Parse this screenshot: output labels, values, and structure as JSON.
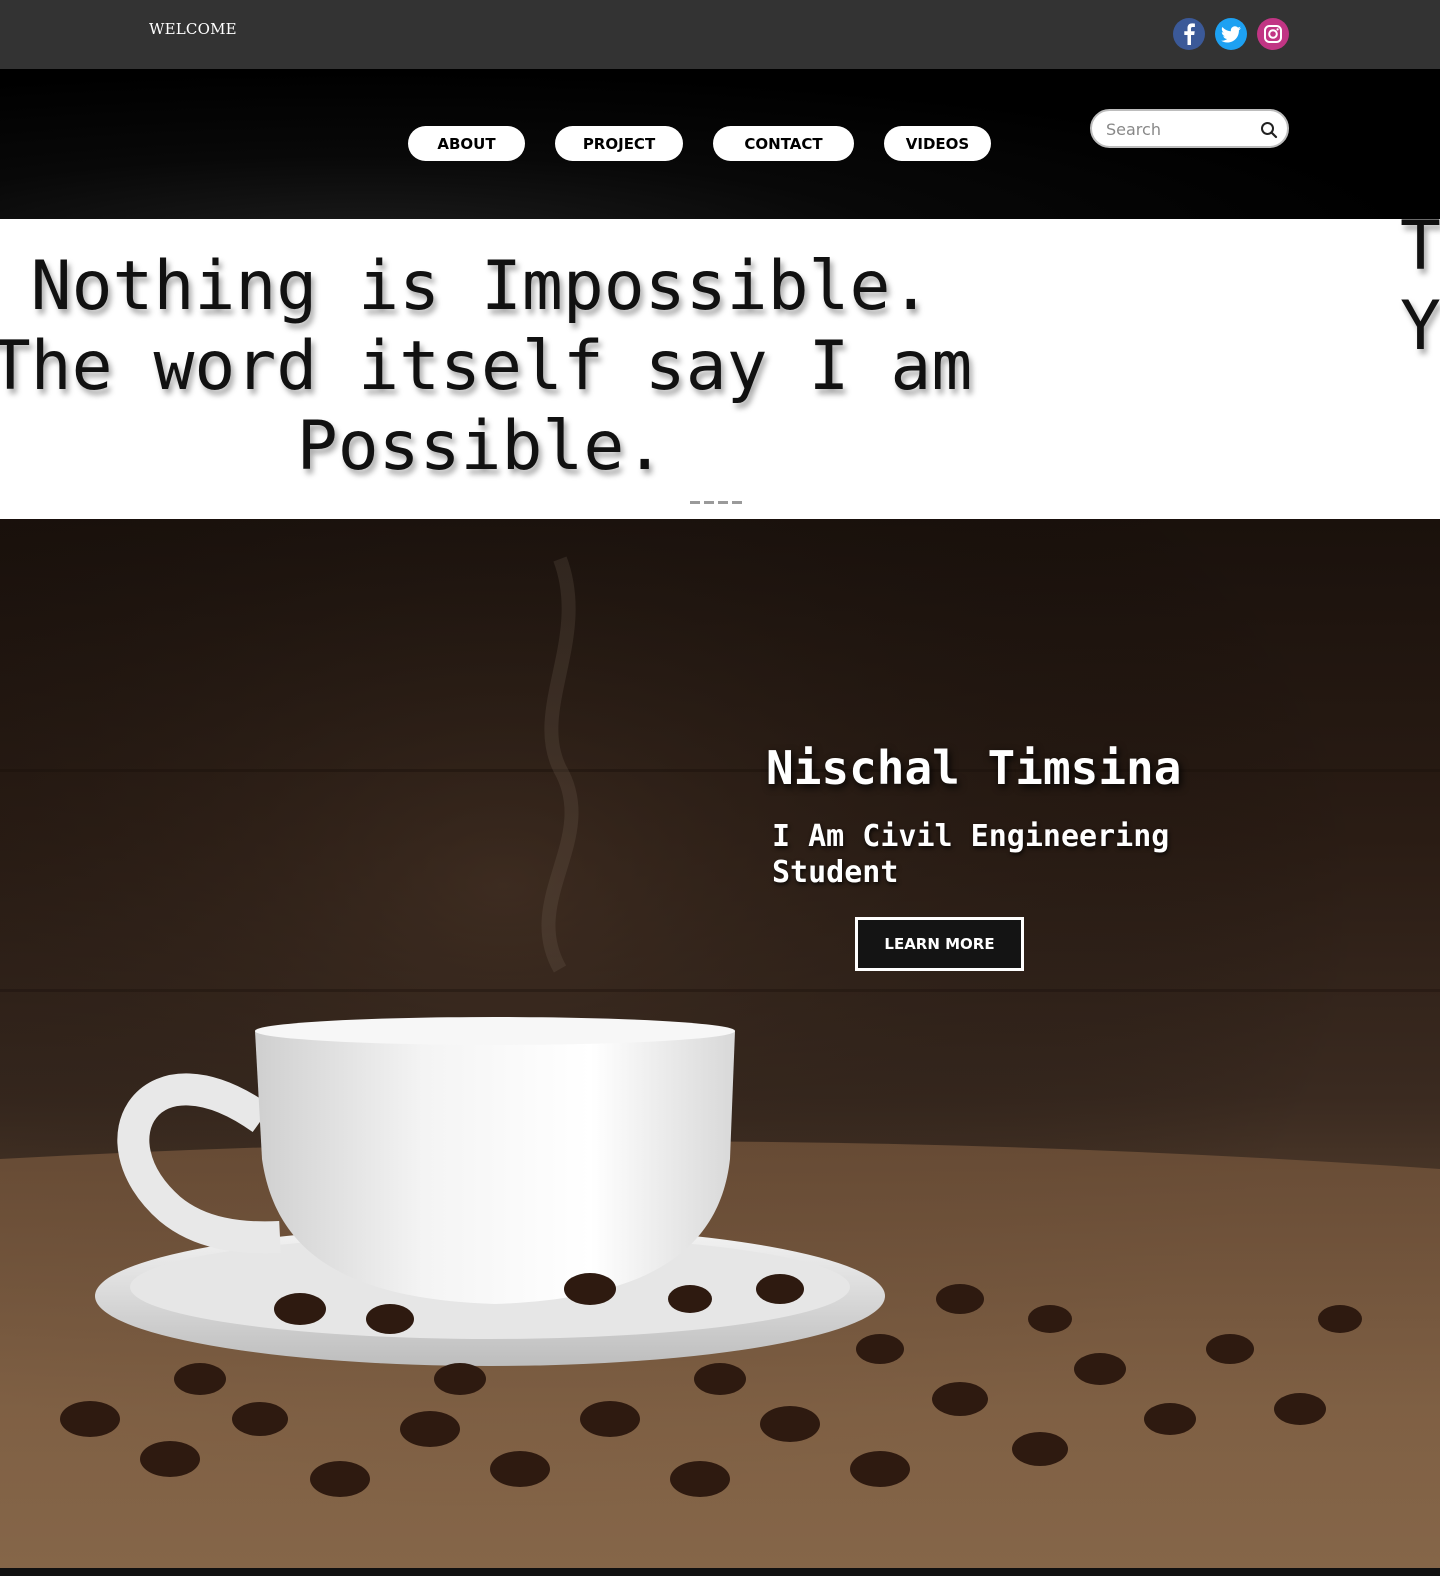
{
  "topbar": {
    "welcome": "WELCOME",
    "social": [
      {
        "icon": "facebook-icon",
        "color": "#3b5998"
      },
      {
        "icon": "twitter-icon",
        "color": "#1da1f2"
      },
      {
        "icon": "instagram-icon",
        "color": "#c13584"
      }
    ]
  },
  "nav": {
    "items": [
      {
        "label": "ABOUT"
      },
      {
        "label": "PROJECT"
      },
      {
        "label": "CONTACT"
      },
      {
        "label": "VIDEOS"
      }
    ],
    "search": {
      "placeholder": "Search",
      "value": ""
    }
  },
  "quote": {
    "text": "Nothing is Impossible.\nThe word itself say I am Possible.",
    "next_slide_partial": "T\nY"
  },
  "hero": {
    "name": "Nischal Timsina",
    "subtitle": "I Am Civil Engineering Student",
    "button": "LEARN MORE"
  },
  "colors": {
    "topbar_bg": "#333333",
    "nav_bg": "#000000",
    "nav_button_bg": "#ffffff",
    "hero_text": "#ffffff"
  }
}
